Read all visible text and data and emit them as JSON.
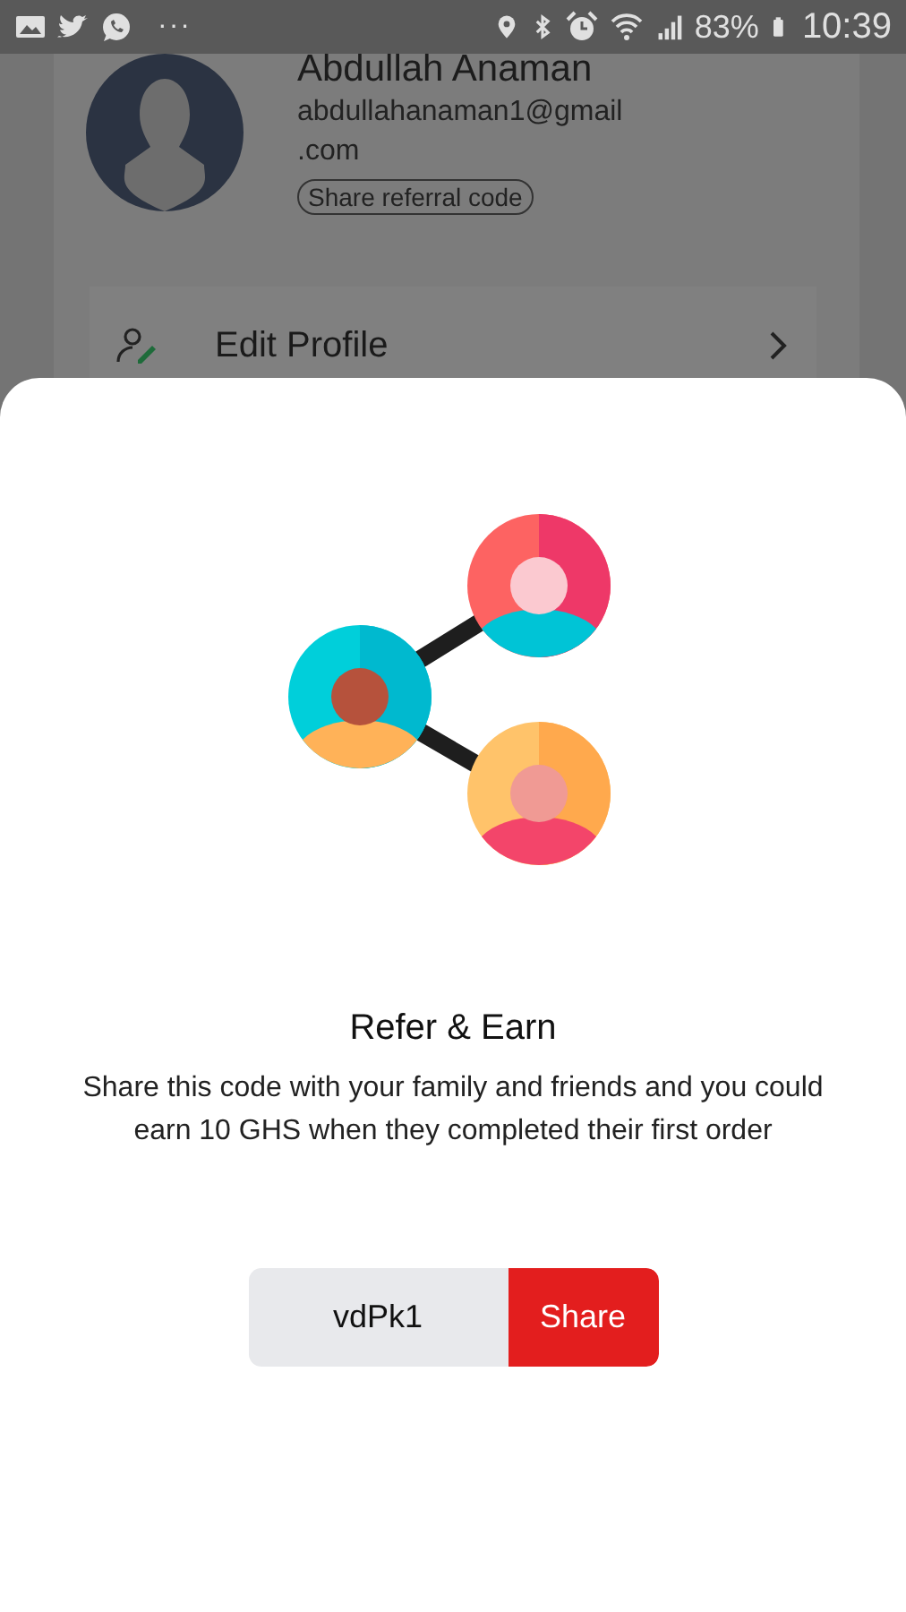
{
  "status_bar": {
    "notification_more": "···",
    "battery": "83%",
    "time": "10:39"
  },
  "profile": {
    "name": "Abdullah Anaman",
    "email": "abdullahanaman1@gmail\n.com",
    "referral_button": "Share referral code",
    "menu": [
      {
        "label": "Edit Profile"
      }
    ]
  },
  "sheet": {
    "title": "Refer & Earn",
    "description": "Share this code with your family and friends and you could earn 10 GHS when they completed their first order",
    "code": "vdPk1",
    "share_button": "Share"
  }
}
